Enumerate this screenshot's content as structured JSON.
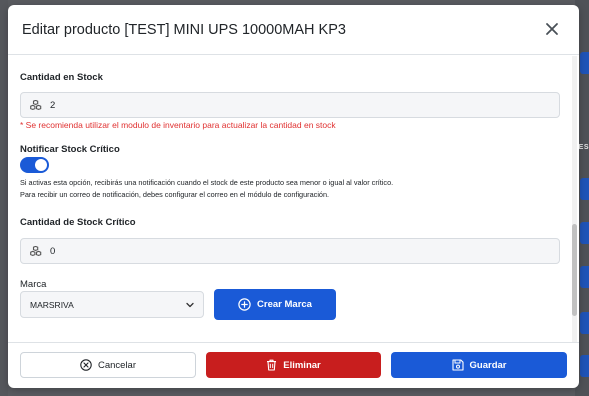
{
  "modal": {
    "title": "Editar producto [TEST] MINI UPS 10000MAH KP3"
  },
  "background": {
    "partial_text": "NES"
  },
  "fields": {
    "stock": {
      "label": "Cantidad en Stock",
      "value": "2",
      "warning": "* Se recomienda utilizar el modulo de inventario para actualizar la cantidad en stock"
    },
    "notify": {
      "label": "Notificar Stock Crítico",
      "enabled": true,
      "help_line1": "Si activas esta opción, recibirás una notificación cuando el stock de este producto sea menor o igual al valor crítico.",
      "help_line2": "Para recibir un correo de notificación, debes configurar el correo en el módulo de configuración."
    },
    "critical": {
      "label": "Cantidad de Stock Crítico",
      "value": "0"
    },
    "brand": {
      "label": "Marca",
      "selected": "MARSRIVA",
      "create_button": "Crear Marca"
    }
  },
  "footer": {
    "cancel": "Cancelar",
    "delete": "Eliminar",
    "save": "Guardar"
  },
  "colors": {
    "primary": "#1a5ad7",
    "danger": "#c81e1e",
    "warning_text": "#e03131"
  },
  "icons": {
    "stock": "cubes-icon",
    "close": "close-icon",
    "chevron": "chevron-down-icon",
    "add": "plus-circle-icon",
    "cancel": "x-circle-icon",
    "delete": "trash-icon",
    "save": "floppy-disk-icon"
  }
}
